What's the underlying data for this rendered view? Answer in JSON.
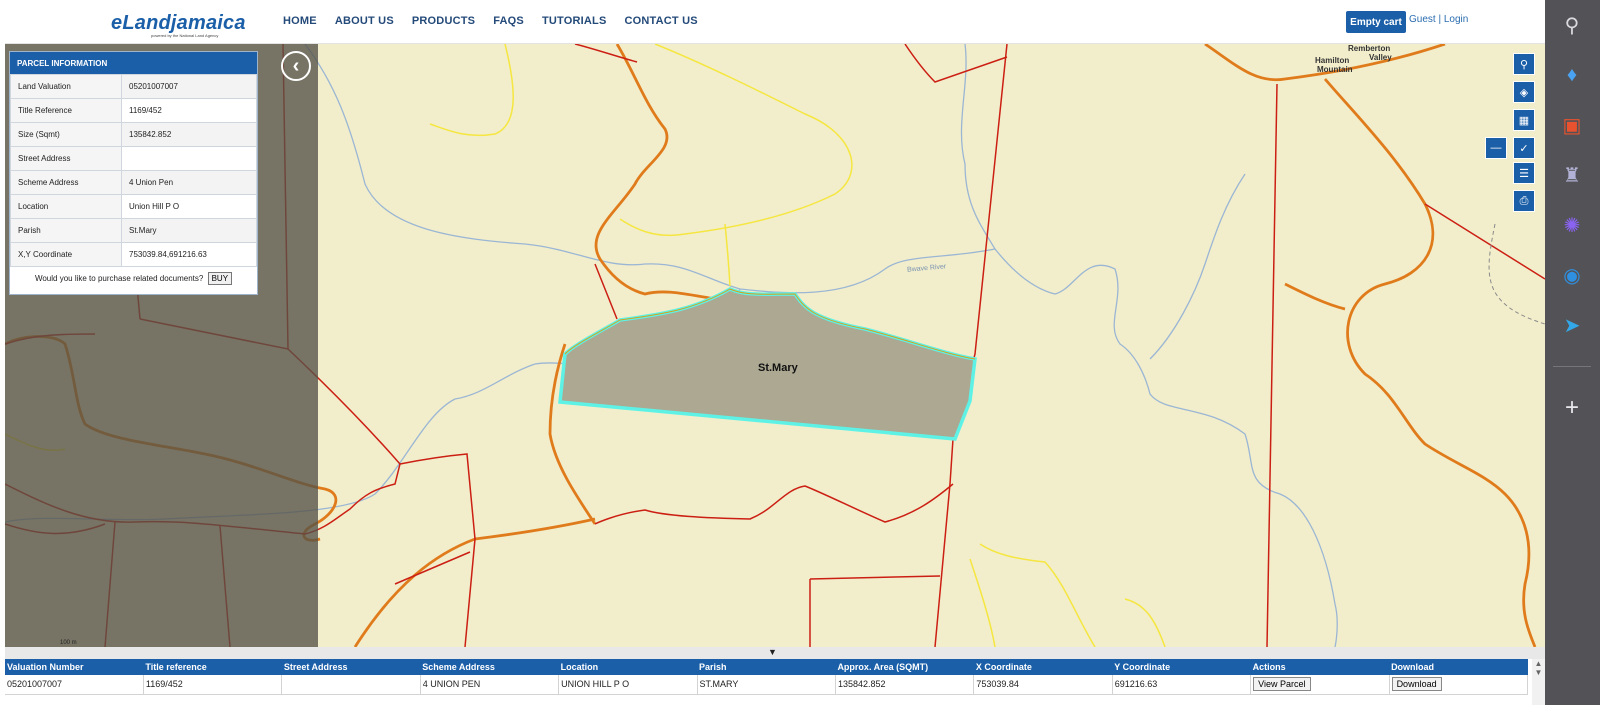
{
  "header": {
    "logo": "eLandjamaica",
    "logo_tagline": "powered by the National Land Agency",
    "nav": [
      "HOME",
      "ABOUT US",
      "PRODUCTS",
      "FAQS",
      "TUTORIALS",
      "CONTACT US"
    ],
    "cart_label": "Empty cart",
    "guest_label": "Guest",
    "separator": "|",
    "login_label": "Login"
  },
  "parcel_panel": {
    "title": "PARCEL INFORMATION",
    "rows": [
      {
        "label": "Land Valuation",
        "value": "05201007007"
      },
      {
        "label": "Title Reference",
        "value": "1169/452"
      },
      {
        "label": "Size (Sqmt)",
        "value": "135842.852"
      },
      {
        "label": "Street Address",
        "value": ""
      },
      {
        "label": "Scheme Address",
        "value": "4 Union Pen"
      },
      {
        "label": "Location",
        "value": "Union Hill P O"
      },
      {
        "label": "Parish",
        "value": "St.Mary"
      },
      {
        "label": "X,Y Coordinate",
        "value": "753039.84,691216.63"
      }
    ],
    "purchase_prompt": "Would you like to purchase related documents?",
    "buy_label": "BUY"
  },
  "map": {
    "parcel_label": "St.Mary",
    "river_label": "Bwave River",
    "place_label_1": "Remberton",
    "place_label_2": "Valley",
    "place_label_3": "Hamilton",
    "place_label_4": "Mountain",
    "scale_label": "100 m",
    "collapse_icon": "chevron-left-icon",
    "tools": [
      "search-icon",
      "layers-icon",
      "grid-icon",
      "minus-icon",
      "measure-icon",
      "list-icon",
      "print-icon"
    ]
  },
  "right_toolbar": {
    "icons": [
      "search-icon",
      "tag-icon",
      "briefcase-icon",
      "chess-icon",
      "copilot-icon",
      "outlook-icon",
      "send-icon",
      "add-icon"
    ]
  },
  "results": {
    "toggle": "▼",
    "columns": [
      "Valuation Number",
      "Title reference",
      "Street Address",
      "Scheme Address",
      "Location",
      "Parish",
      "Approx. Area (SQMT)",
      "X Coordinate",
      "Y Coordinate",
      "Actions",
      "Download"
    ],
    "row": {
      "valuation": "05201007007",
      "title": "1169/452",
      "street": "",
      "scheme": "4 UNION PEN",
      "location": "UNION HILL P O",
      "parish": "ST.MARY",
      "area": "135842.852",
      "x": "753039.84",
      "y": "691216.63",
      "action_label": "View Parcel",
      "download_label": "Download"
    },
    "scroll_up": "▲",
    "scroll_down": "▼"
  },
  "colors": {
    "brand_blue": "#1b5fa8",
    "map_bg": "#f2eecb",
    "parcel_fill": "#aca892",
    "parcel_outline": "#5ef2e6",
    "boundary_red": "#cc1f14",
    "road_orange": "#e07b1c",
    "river_blue": "#9bb6d4",
    "track_yellow": "#f5e640"
  }
}
